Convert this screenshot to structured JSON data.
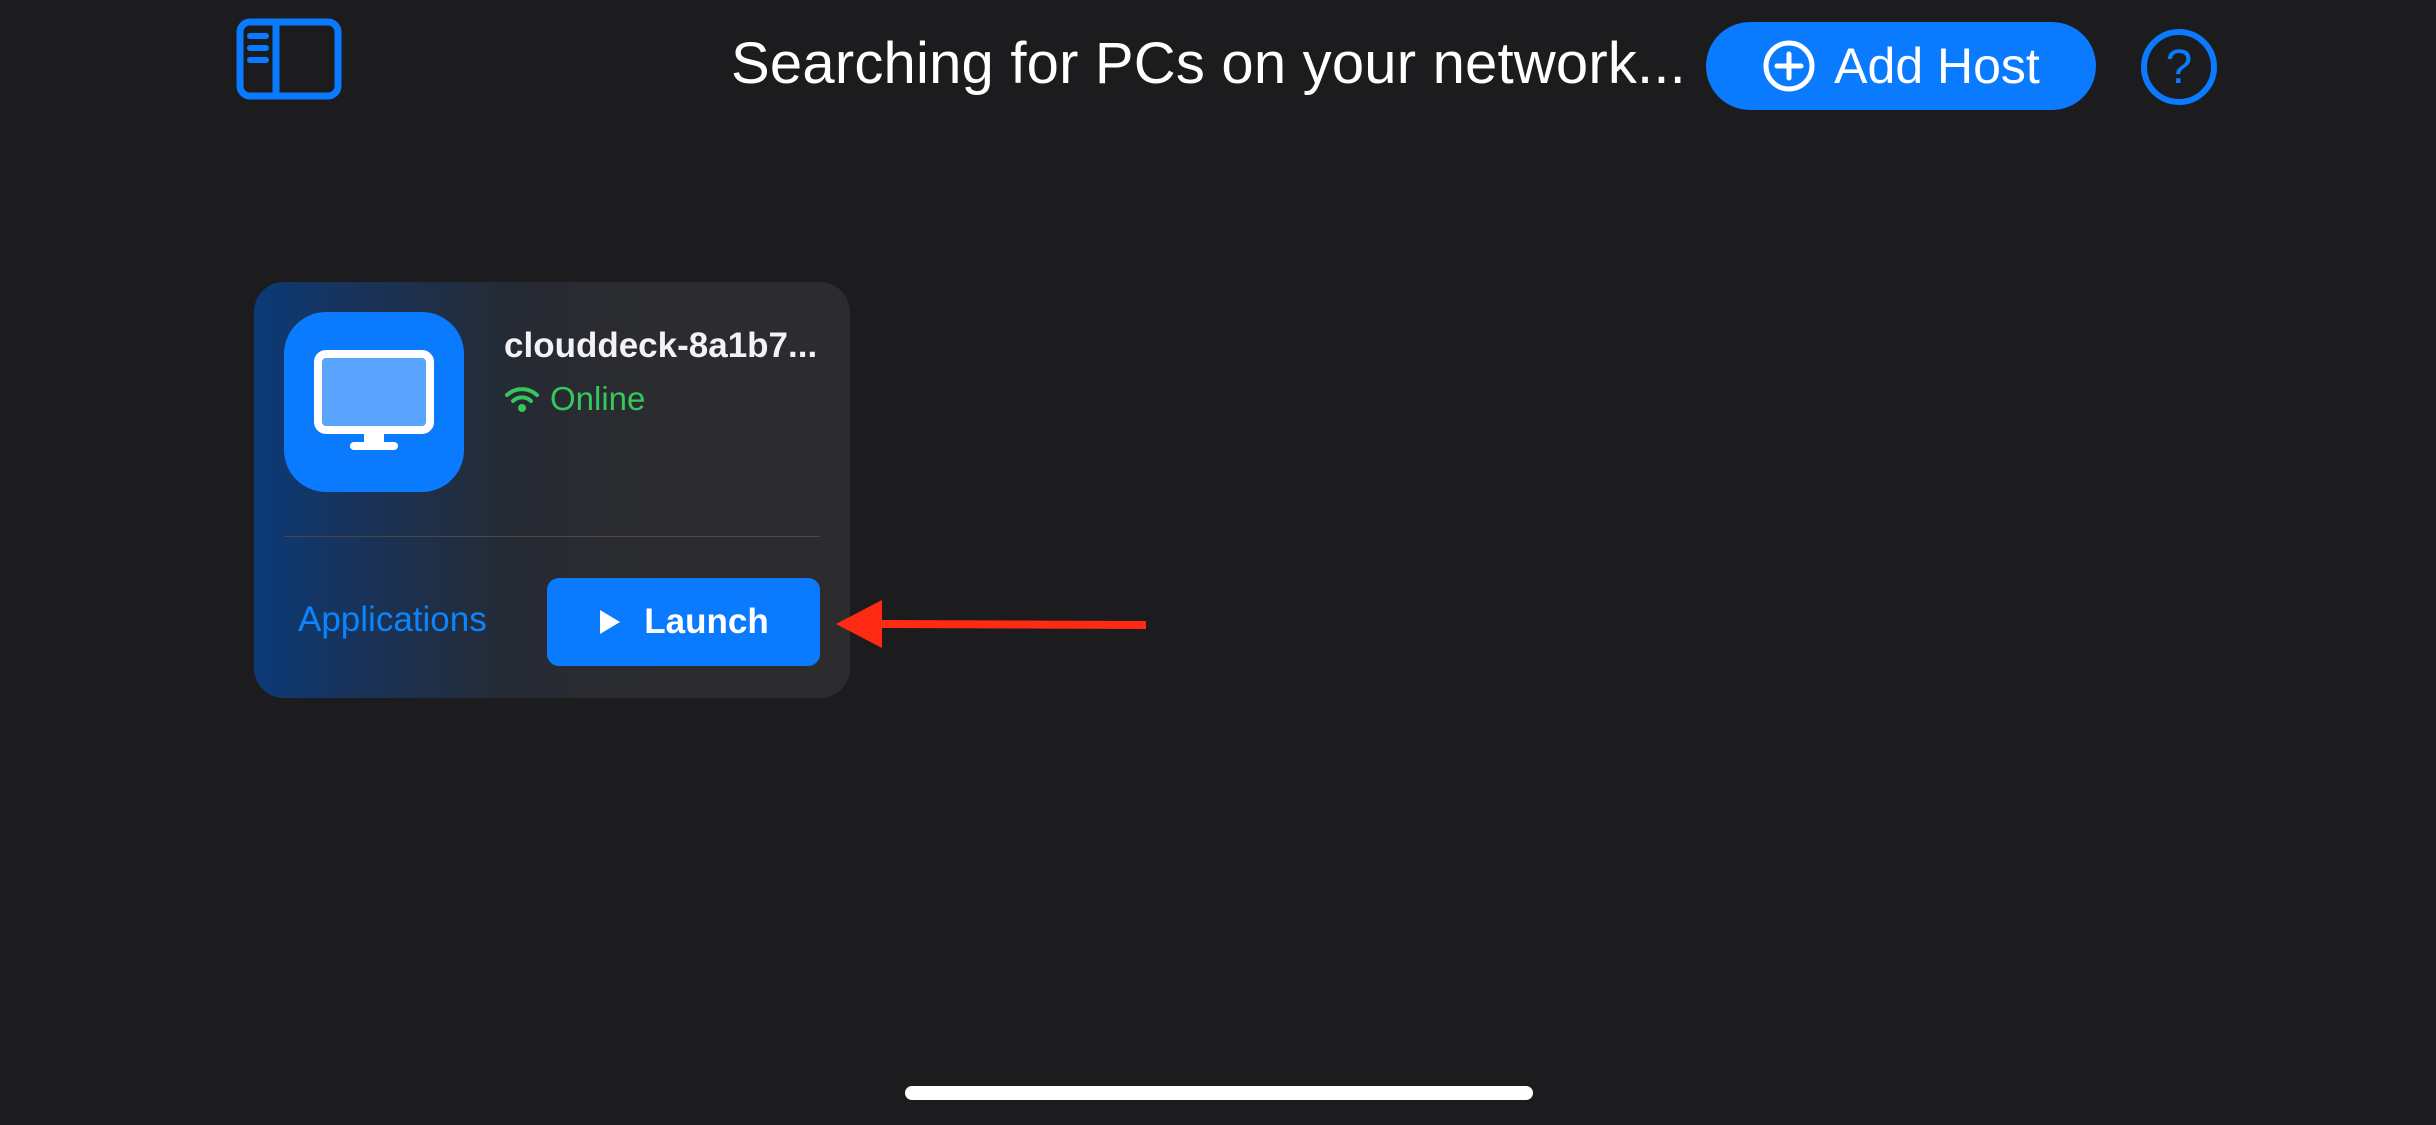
{
  "header": {
    "title": "Searching for PCs on your network...",
    "add_host_label": "Add Host",
    "help_label": "?"
  },
  "host": {
    "name": "clouddeck-8a1b7...",
    "status": "Online",
    "applications_label": "Applications",
    "launch_label": "Launch"
  },
  "icons": {
    "sidebar_toggle": "sidebar-toggle-icon",
    "add": "plus-circle-icon",
    "help": "question-circle-icon",
    "host": "desktop-monitor-icon",
    "status": "wifi-icon",
    "launch": "play-icon",
    "annotation": "red-arrow-icon"
  },
  "colors": {
    "background": "#1c1c1e",
    "accent": "#0a7aff",
    "online": "#34c759",
    "card": "#2c2c2e",
    "annotation": "#ff2a12"
  }
}
